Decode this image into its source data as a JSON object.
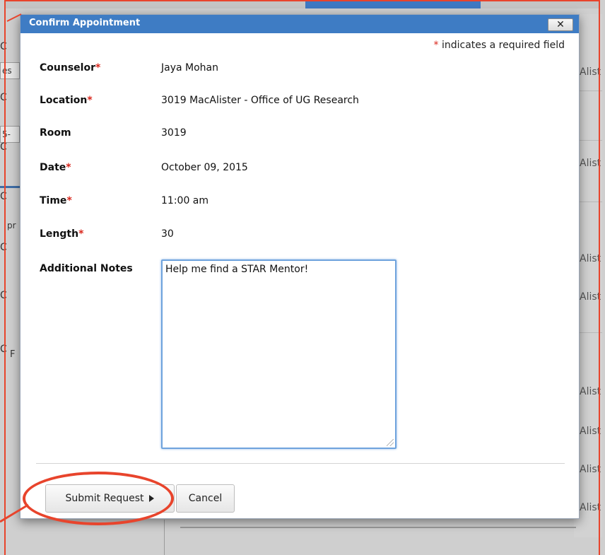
{
  "dialog": {
    "title": "Confirm Appointment",
    "close_label": "✕",
    "required_star": "*",
    "required_note": "indicates a required field"
  },
  "fields": [
    {
      "label": "Counselor",
      "required": "*",
      "value": "Jaya Mohan"
    },
    {
      "label": "Location",
      "required": "*",
      "value": "3019 MacAlister - Office of UG Research"
    },
    {
      "label": "Room",
      "required": "",
      "value": "3019"
    },
    {
      "label": "Date",
      "required": "*",
      "value": "October 09, 2015"
    },
    {
      "label": "Time",
      "required": "*",
      "value": "11:00 am"
    },
    {
      "label": "Length",
      "required": "*",
      "value": "30"
    }
  ],
  "notes": {
    "label": "Additional Notes",
    "value": "Help me find a STAR Mentor!"
  },
  "buttons": {
    "submit_label": "Submit Request",
    "cancel_label": "Cancel"
  },
  "background": {
    "right_fragments": [
      "Alist",
      "Alist",
      "Alist",
      "Alist",
      "Alist",
      "Alist",
      "Alist",
      "Alist"
    ],
    "left_fragments": [
      "C",
      "es",
      "C",
      "5-",
      "C",
      "pr",
      "C",
      "F"
    ]
  },
  "colors": {
    "header": "#3e7cc4",
    "required_star": "#d9261c",
    "annotation": "#e8442c",
    "focus_ring": "#6fa3dd"
  }
}
